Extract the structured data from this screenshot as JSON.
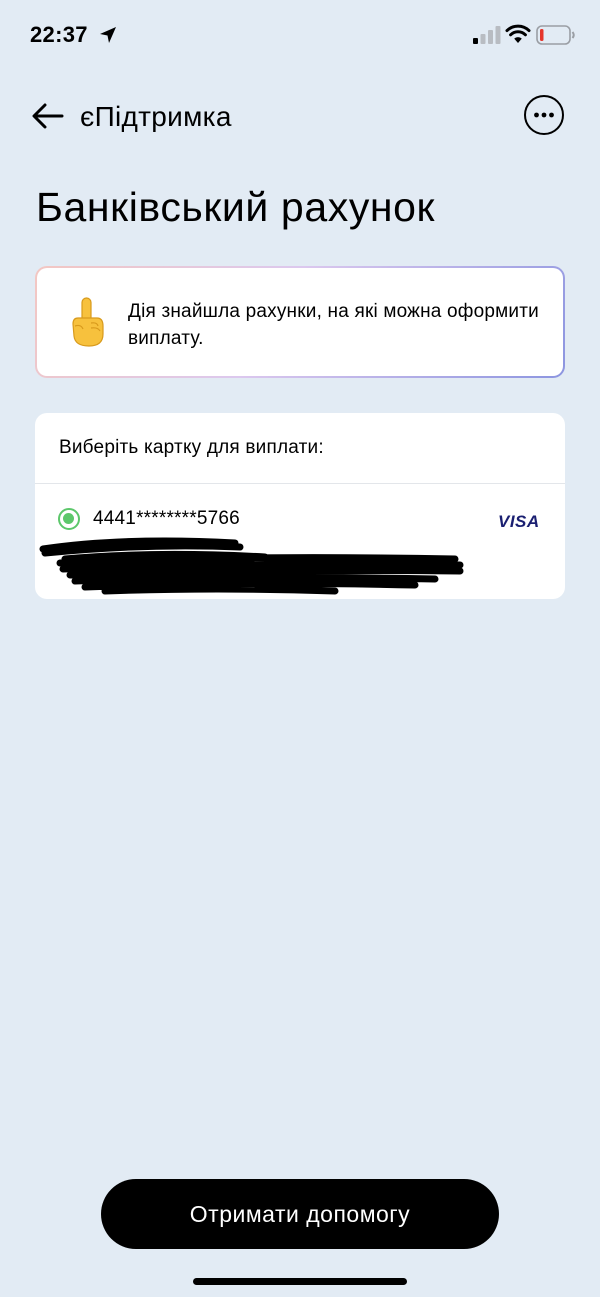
{
  "status_bar": {
    "time": "22:37",
    "icons": [
      "location-arrow-icon",
      "cellular-signal-icon",
      "wifi-icon",
      "battery-low-icon"
    ]
  },
  "header": {
    "back_icon": "arrow-left-icon",
    "app_title": "єПідтримка",
    "more_icon": "more-horizontal-icon"
  },
  "page": {
    "title": "Банківський рахунок"
  },
  "info_banner": {
    "icon": "pointing-up-hand-icon",
    "text": "Дія знайшла рахунки, на які можна оформити виплату."
  },
  "card_selection": {
    "header": "Виберіть картку для виплати:",
    "cards": [
      {
        "number": "4441********5766",
        "brand": "VISA",
        "selected": true
      }
    ]
  },
  "footer": {
    "help_button_label": "Отримати допомогу"
  },
  "colors": {
    "background": "#e2ebf4",
    "radio_selected": "#5cc76b",
    "visa_brand": "#1a1f71",
    "button": "#000000"
  }
}
